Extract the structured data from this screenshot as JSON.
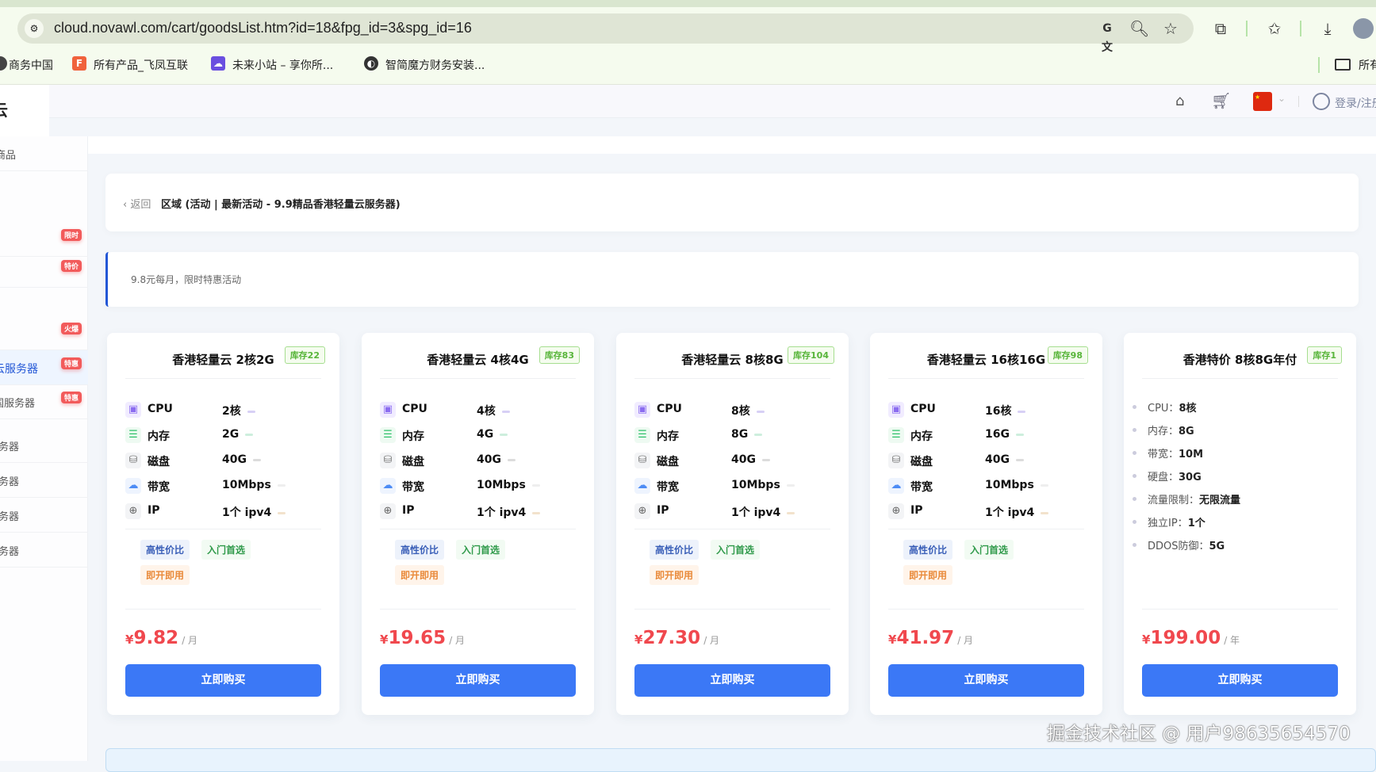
{
  "browser": {
    "url": "cloud.novawl.com/cart/goodsList.htm?id=18&fpg_id=3&spg_id=16",
    "bookmarks": [
      {
        "label": "商务中国",
        "icon": "globe-icon"
      },
      {
        "label": "所有产品_飞凤互联",
        "icon": "feifeng-logo-icon"
      },
      {
        "label": "未来小站 – 享你所...",
        "icon": "cloud-logo-icon"
      },
      {
        "label": "智简魔方财务安装...",
        "icon": "globe-icon"
      }
    ],
    "bookmarks_folder": "所有"
  },
  "header": {
    "login_label": "登录/注册",
    "logo_text": "云"
  },
  "sidebar": {
    "items": [
      {
        "label": "商品",
        "badge": ""
      },
      {
        "label": "",
        "badge": "限时"
      },
      {
        "label": "",
        "badge": "特价"
      },
      {
        "label": "",
        "badge": "火爆"
      },
      {
        "label": "云服务器",
        "badge": "特惠",
        "active": true
      },
      {
        "label": "国服务器",
        "badge": "特惠"
      },
      {
        "label": "务器",
        "badge": ""
      },
      {
        "label": "务器",
        "badge": ""
      },
      {
        "label": "务器",
        "badge": ""
      },
      {
        "label": "务器",
        "badge": ""
      }
    ]
  },
  "breadcrumb": {
    "back_label": "返回",
    "title": "区域 (活动 | 最新活动 - 9.9精品香港轻量云服务器)"
  },
  "notice": {
    "text": "9.8元每月，限时特惠活动"
  },
  "products": [
    {
      "title": "香港轻量云 2核2G",
      "stock": "库存22",
      "specs": {
        "CPU": "2核",
        "内存": "2G",
        "磁盘": "40G",
        "带宽": "10Mbps",
        "IP": "1个 ipv4"
      },
      "tags": [
        "高性价比",
        "入门首选",
        "即开即用"
      ],
      "currency": "¥",
      "price": "9.82",
      "unit": "/ 月",
      "buy_label": "立即购买"
    },
    {
      "title": "香港轻量云 4核4G",
      "stock": "库存83",
      "specs": {
        "CPU": "4核",
        "内存": "4G",
        "磁盘": "40G",
        "带宽": "10Mbps",
        "IP": "1个 ipv4"
      },
      "tags": [
        "高性价比",
        "入门首选",
        "即开即用"
      ],
      "currency": "¥",
      "price": "19.65",
      "unit": "/ 月",
      "buy_label": "立即购买"
    },
    {
      "title": "香港轻量云 8核8G",
      "stock": "库存104",
      "specs": {
        "CPU": "8核",
        "内存": "8G",
        "磁盘": "40G",
        "带宽": "10Mbps",
        "IP": "1个 ipv4"
      },
      "tags": [
        "高性价比",
        "入门首选",
        "即开即用"
      ],
      "currency": "¥",
      "price": "27.30",
      "unit": "/ 月",
      "buy_label": "立即购买"
    },
    {
      "title": "香港轻量云 16核16G",
      "stock": "库存98",
      "specs": {
        "CPU": "16核",
        "内存": "16G",
        "磁盘": "40G",
        "带宽": "10Mbps",
        "IP": "1个 ipv4"
      },
      "tags": [
        "高性价比",
        "入门首选",
        "即开即用"
      ],
      "currency": "¥",
      "price": "41.97",
      "unit": "/ 月",
      "buy_label": "立即购买"
    },
    {
      "title": "香港特价 8核8G年付",
      "stock": "库存1",
      "list": [
        {
          "k": "CPU：",
          "v": "8核"
        },
        {
          "k": "内存：",
          "v": "8G"
        },
        {
          "k": "带宽：",
          "v": "10M"
        },
        {
          "k": "硬盘：",
          "v": "30G"
        },
        {
          "k": "流量限制：",
          "v": "无限流量"
        },
        {
          "k": "独立IP：",
          "v": "1个"
        },
        {
          "k": "DDOS防御：",
          "v": "5G"
        }
      ],
      "currency": "¥",
      "price": "199.00",
      "unit": "/ 年",
      "buy_label": "立即购买"
    }
  ],
  "spec_keys": [
    "CPU",
    "内存",
    "磁盘",
    "带宽",
    "IP"
  ],
  "watermark": "掘金技术社区 @ 用户98635654570",
  "colors": {
    "accent": "#3b78f6",
    "price": "#f0484e",
    "badge": "#f25b5b",
    "stock": "#58b53a"
  }
}
